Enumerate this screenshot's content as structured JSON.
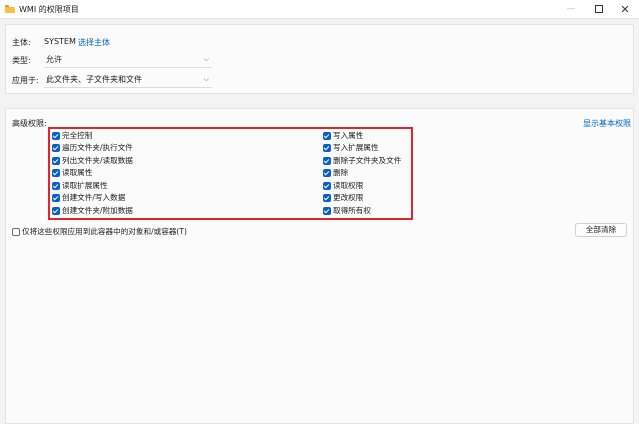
{
  "window": {
    "title": "WMI 的权限项目",
    "minimize": "—",
    "close": "✕"
  },
  "principal": {
    "label": "主体:",
    "value": "SYSTEM",
    "select_link": "选择主体"
  },
  "type": {
    "label": "类型:",
    "value": "允许"
  },
  "applies_to": {
    "label": "应用于:",
    "value": "此文件夹、子文件夹和文件"
  },
  "advanced": {
    "label": "高级权限:",
    "show_basic_link": "显示基本权限",
    "left_permissions": [
      {
        "label": "完全控制",
        "checked": true
      },
      {
        "label": "遍历文件夹/执行文件",
        "checked": true
      },
      {
        "label": "列出文件夹/读取数据",
        "checked": true
      },
      {
        "label": "读取属性",
        "checked": true
      },
      {
        "label": "读取扩展属性",
        "checked": true
      },
      {
        "label": "创建文件/写入数据",
        "checked": true
      },
      {
        "label": "创建文件夹/附加数据",
        "checked": true
      }
    ],
    "right_permissions": [
      {
        "label": "写入属性",
        "checked": true
      },
      {
        "label": "写入扩展属性",
        "checked": true
      },
      {
        "label": "删除子文件夹及文件",
        "checked": true
      },
      {
        "label": "删除",
        "checked": true
      },
      {
        "label": "读取权限",
        "checked": true
      },
      {
        "label": "更改权限",
        "checked": true
      },
      {
        "label": "取得所有权",
        "checked": true
      }
    ],
    "apply_only_label": "仅将这些权限应用到此容器中的对象和/或容器(T)",
    "apply_only_checked": false,
    "clear_all_button": "全部清除"
  },
  "colors": {
    "accent": "#0a5fc7",
    "link": "#0067c0",
    "highlight_box": "#e0252b"
  }
}
